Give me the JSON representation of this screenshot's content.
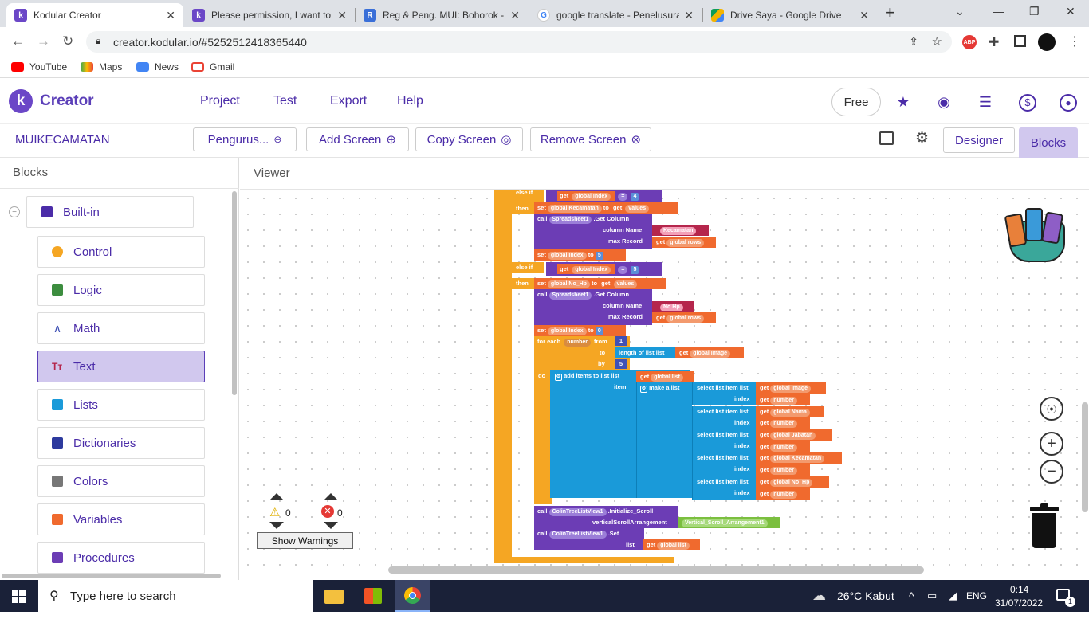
{
  "browser": {
    "tabs": [
      {
        "title": "Kodular Creator",
        "active": true,
        "icon": "kodular-favicon",
        "color": "#6b47c7"
      },
      {
        "title": "Please permission, I want to a",
        "active": false,
        "icon": "kodular-favicon",
        "color": "#6b47c7"
      },
      {
        "title": "Reg & Peng. MUI: Bohorok -",
        "active": false,
        "icon": "community-favicon",
        "color": "#3a6fd8"
      },
      {
        "title": "google translate - Penelusura",
        "active": false,
        "icon": "google-favicon",
        "color": "#4285f4"
      },
      {
        "title": "Drive Saya - Google Drive",
        "active": false,
        "icon": "drive-favicon",
        "color": "#0f9d58"
      }
    ],
    "url": "creator.kodular.io/#5252512418365440",
    "bookmarks": [
      {
        "label": "YouTube",
        "icon": "youtube-icon",
        "color": "#ff0000"
      },
      {
        "label": "Maps",
        "icon": "maps-icon",
        "color": "#34a853"
      },
      {
        "label": "News",
        "icon": "news-icon",
        "color": "#4285f4"
      },
      {
        "label": "Gmail",
        "icon": "gmail-icon",
        "color": "#ea4335"
      }
    ]
  },
  "app": {
    "brand": "Creator",
    "menu": [
      "Project",
      "Test",
      "Export",
      "Help"
    ],
    "plan": "Free",
    "project_name": "MUIKECAMATAN",
    "screen_select": "Pengurus...",
    "add_screen": "Add Screen",
    "copy_screen": "Copy Screen",
    "remove_screen": "Remove Screen",
    "designer": "Designer",
    "blocks_tab": "Blocks",
    "accent": "#5b3fb8"
  },
  "blocks_panel": {
    "title": "Blocks",
    "builtin": "Built-in",
    "categories": [
      {
        "label": "Control",
        "color": "#f5a623"
      },
      {
        "label": "Logic",
        "color": "#3c8d3f"
      },
      {
        "label": "Math",
        "color": "#3f51b5"
      },
      {
        "label": "Text",
        "color": "#b5264c",
        "selected": true
      },
      {
        "label": "Lists",
        "color": "#1a9ad9"
      },
      {
        "label": "Dictionaries",
        "color": "#2d3a9e"
      },
      {
        "label": "Colors",
        "color": "#777777"
      },
      {
        "label": "Variables",
        "color": "#f06a2e"
      },
      {
        "label": "Procedures",
        "color": "#6c3db5"
      }
    ]
  },
  "viewer": {
    "title": "Viewer",
    "warnings": "0",
    "errors": "0",
    "show_warnings": "Show Warnings"
  },
  "blocks": {
    "else_if": "else if",
    "then": "then",
    "get": "get",
    "set": "set",
    "call": "call",
    "to": "to",
    "do": "do",
    "global_index": "global Index",
    "eq": "=",
    "num4": "4",
    "num5": "5",
    "num0": "0",
    "num1": "1",
    "global_kecamatan": "global Kecamatan",
    "values": "values",
    "spreadsheet": "Spreadsheet1",
    "get_column": ".Get Column",
    "column_name": "column Name",
    "max_record": "max Record",
    "kecamatan_text": "Kecamatan",
    "global_rows": "global rows",
    "global_nohp": "global No_Hp",
    "nohp_text": "No Hp",
    "for_each": "for each",
    "number": "number",
    "from": "from",
    "by": "by",
    "length_of_list": "length of list",
    "list": "list",
    "global_image": "global Image",
    "add_items": "add items to list",
    "global_list": "global list",
    "item": "item",
    "make_a_list": "make a list",
    "select_list_item": "select list item",
    "index": "index",
    "global_nama": "global Nama",
    "global_jabatan": "global Jabatan",
    "colin": "ColinTreeListView1",
    "init_scroll": ".Initialize_Scroll",
    "vsa": "verticalScrollArrangement",
    "vsa_val": "Vertical_Scroll_Arrangement1",
    "set_call": ".Set"
  },
  "taskbar": {
    "search_placeholder": "Type here to search",
    "weather": "26°C  Kabut",
    "lang": "ENG",
    "time": "0:14",
    "date": "31/07/2022",
    "notif_count": "1"
  }
}
